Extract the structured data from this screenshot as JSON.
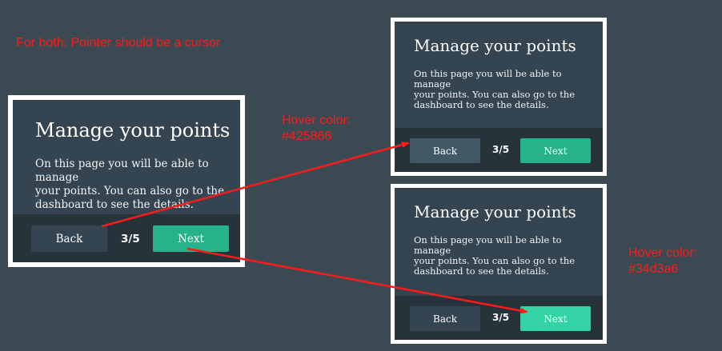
{
  "notes": {
    "cursor": "For both: Pointer should be a cursor",
    "back_hover": "Hover color:\n#425866",
    "next_hover": "Hover color:\n#34d3a6"
  },
  "colors": {
    "back_hover": "#425866",
    "next_hover": "#34d3a6",
    "annotation": "#ff1a1a"
  },
  "cards": {
    "default": {
      "title": "Manage your points",
      "text": "On this page you will be able to manage\nyour points. You can also go to the\ndashboard to see the details.",
      "back_label": "Back",
      "counter": "3/5",
      "next_label": "Next"
    },
    "back_hover": {
      "title": "Manage your points",
      "text": "On this page you will be able to manage\nyour points. You can also go to the\ndashboard to see the details.",
      "back_label": "Back",
      "counter": "3/5",
      "next_label": "Next"
    },
    "next_hover": {
      "title": "Manage your points",
      "text": "On this page you will be able to manage\nyour points. You can also go to the\ndashboard to see the details.",
      "back_label": "Back",
      "counter": "3/5",
      "next_label": "Next"
    }
  }
}
